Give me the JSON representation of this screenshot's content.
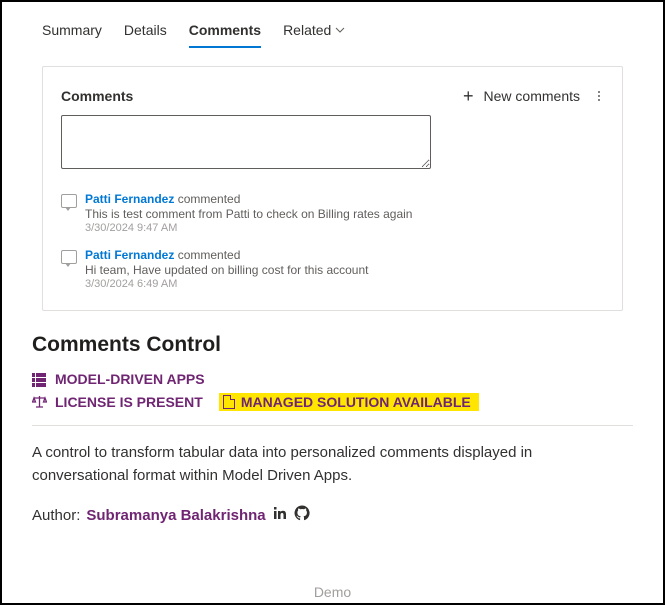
{
  "tabs": {
    "summary": "Summary",
    "details": "Details",
    "comments": "Comments",
    "related": "Related"
  },
  "panel": {
    "title": "Comments",
    "new_label": "New comments",
    "input_value": "",
    "items": [
      {
        "author": "Patti Fernandez",
        "action": "commented",
        "text": "This is test comment from Patti to check on Billing rates again",
        "time": "3/30/2024 9:47 AM"
      },
      {
        "author": "Patti Fernandez",
        "action": "commented",
        "text": "Hi team, Have updated on billing cost for this account",
        "time": "3/30/2024 6:49 AM"
      }
    ]
  },
  "section": {
    "title": "Comments Control",
    "badge_model": "MODEL-DRIVEN APPS",
    "badge_license": "LICENSE IS PRESENT",
    "badge_managed": "MANAGED SOLUTION AVAILABLE",
    "description": "A control to transform tabular data into personalized comments displayed in conversational format within Model Driven Apps.",
    "author_label": "Author:",
    "author_name": "Subramanya Balakrishna"
  },
  "footer": "Demo"
}
